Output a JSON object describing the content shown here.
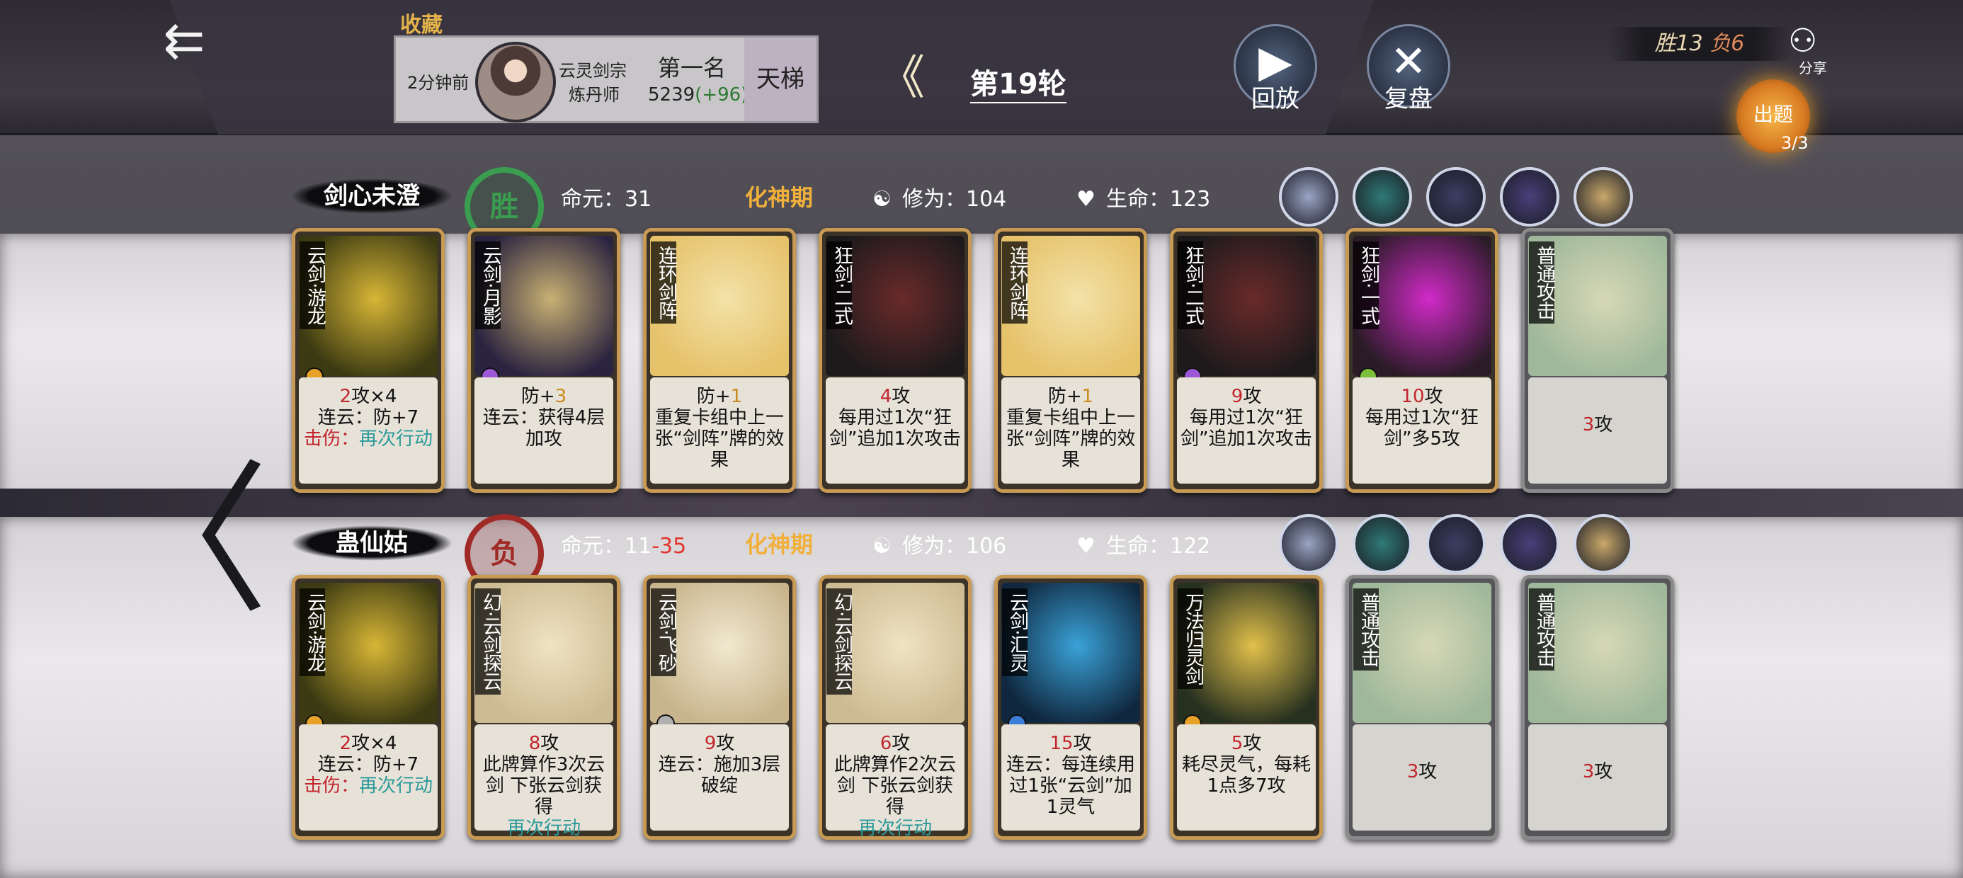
{
  "header": {
    "back_icon": "back-arrow-icon",
    "collect_label": "收藏",
    "opponent": {
      "time": "2分钟前",
      "sect": "云灵剑宗",
      "role": "炼丹师",
      "rank": "第一名",
      "score": "5239",
      "score_delta": "(+96)",
      "ladder": "天梯"
    },
    "round_label": "第19轮",
    "replay_label": "回放",
    "review_label": "复盘",
    "record_win": "胜13",
    "record_lose": "负6",
    "share_label": "分享",
    "exam_label": "出题",
    "exam_count": "3/3"
  },
  "players": [
    {
      "name": "剑心未澄",
      "result": "胜",
      "mingyuan_label": "命元：",
      "mingyuan": "31",
      "mingyuan_loss": "",
      "realm": "化神期",
      "cultivation_label": "修为：",
      "cultivation": "104",
      "hp_label": "生命：",
      "hp": "123",
      "cards": [
        {
          "title": "云剑·游龙",
          "gem": "#e6a126",
          "art": [
            "#3b3a12",
            "#d8b636"
          ],
          "d1": [
            "2",
            "攻×4"
          ],
          "d2": "连云：防+7",
          "d3": [
            "击伤：",
            "再次行动"
          ]
        },
        {
          "title": "云剑·月影",
          "gem": "#9b57d6",
          "art": [
            "#2b2440",
            "#c8b073"
          ],
          "d1": [
            "防+",
            "3"
          ],
          "d2": "连云：获得4层加攻",
          "d3": [
            "",
            ""
          ]
        },
        {
          "title": "连环剑阵",
          "gem": "",
          "art": [
            "#e6c26a",
            "#f3e2a8"
          ],
          "d1": [
            "防+",
            "1"
          ],
          "d2": "重复卡组中上一张“剑阵”牌的效果",
          "d3": [
            "",
            ""
          ]
        },
        {
          "title": "狂剑·二式",
          "gem": "",
          "art": [
            "#1d1a1c",
            "#6a2a2a"
          ],
          "d1": [
            "4",
            "攻"
          ],
          "d2": "每用过1次“狂剑”追加1次攻击",
          "d3": [
            "",
            ""
          ]
        },
        {
          "title": "连环剑阵",
          "gem": "",
          "art": [
            "#e6c26a",
            "#f3e2a8"
          ],
          "d1": [
            "防+",
            "1"
          ],
          "d2": "重复卡组中上一张“剑阵”牌的效果",
          "d3": [
            "",
            ""
          ]
        },
        {
          "title": "狂剑·二式",
          "gem": "#9b57d6",
          "art": [
            "#1d1a1c",
            "#6a2a2a"
          ],
          "d1": [
            "9",
            "攻"
          ],
          "d2": "每用过1次“狂剑”追加1次攻击",
          "d3": [
            "",
            ""
          ]
        },
        {
          "title": "狂剑·一式",
          "gem": "#7dbf3a",
          "art": [
            "#2a1b27",
            "#d22ac8"
          ],
          "d1": [
            "10",
            "攻"
          ],
          "d2": "每用过1次“狂剑”多5攻",
          "d3": [
            "",
            ""
          ]
        },
        {
          "title": "普通攻击",
          "gem": "",
          "normal": true,
          "art": [
            "#9fb79a",
            "#d6d8b6"
          ],
          "d1": [
            "3",
            "攻"
          ],
          "d2": "",
          "d3": [
            "",
            ""
          ]
        }
      ],
      "icons": [
        "avatar-icon",
        "wind-icon",
        "character-icon",
        "sword-icon",
        "scroll-icon"
      ]
    },
    {
      "name": "蛊仙姑",
      "result": "负",
      "mingyuan_label": "命元：",
      "mingyuan": "11",
      "mingyuan_loss": "-35",
      "realm": "化神期",
      "cultivation_label": "修为：",
      "cultivation": "106",
      "hp_label": "生命：",
      "hp": "122",
      "cards": [
        {
          "title": "云剑·游龙",
          "gem": "#e6a126",
          "art": [
            "#3b3a12",
            "#d8b636"
          ],
          "d1": [
            "2",
            "攻×4"
          ],
          "d2": "连云：防+7",
          "d3": [
            "击伤：",
            "再次行动"
          ]
        },
        {
          "title": "幻·云剑探云",
          "gem": "",
          "art": [
            "#cdbb93",
            "#efe3c2"
          ],
          "d1": [
            "8",
            "攻"
          ],
          "d2": "此牌算作3次云剑 下张云剑获得",
          "d3": [
            "",
            "再次行动"
          ]
        },
        {
          "title": "云剑·飞砂",
          "gem": "#b0b0b0",
          "art": [
            "#c8b58d",
            "#f1e8cf"
          ],
          "d1": [
            "9",
            "攻"
          ],
          "d2": "连云：施加3层破绽",
          "d3": [
            "",
            ""
          ]
        },
        {
          "title": "幻·云剑探云",
          "gem": "",
          "art": [
            "#cdbb93",
            "#efe3c2"
          ],
          "d1": [
            "6",
            "攻"
          ],
          "d2": "此牌算作2次云剑 下张云剑获得",
          "d3": [
            "",
            "再次行动"
          ]
        },
        {
          "title": "云剑·汇灵",
          "gem": "#3a7ed8",
          "art": [
            "#10283f",
            "#3aa2d8"
          ],
          "d1": [
            "15",
            "攻"
          ],
          "d2": "连云：每连续用过1张“云剑”加1灵气",
          "d3": [
            "",
            ""
          ]
        },
        {
          "title": "万法归灵剑",
          "gem": "#e6a126",
          "art": [
            "#26301f",
            "#e2c04b"
          ],
          "d1": [
            "5",
            "攻"
          ],
          "d2": "耗尽灵气，每耗1点多7攻",
          "d3": [
            "",
            ""
          ]
        },
        {
          "title": "普通攻击",
          "gem": "",
          "normal": true,
          "art": [
            "#9fb79a",
            "#d6d8b6"
          ],
          "d1": [
            "3",
            "攻"
          ],
          "d2": "",
          "d3": [
            "",
            ""
          ]
        },
        {
          "title": "普通攻击",
          "gem": "",
          "normal": true,
          "art": [
            "#9fb79a",
            "#d6d8b6"
          ],
          "d1": [
            "3",
            "攻"
          ],
          "d2": "",
          "d3": [
            "",
            ""
          ]
        }
      ],
      "icons": [
        "question-icon",
        "shadow-icon",
        "tower-icon",
        "hand-icon",
        "sun-icon"
      ]
    }
  ],
  "nav": {
    "prev_icon": "chevron-left-icon"
  }
}
